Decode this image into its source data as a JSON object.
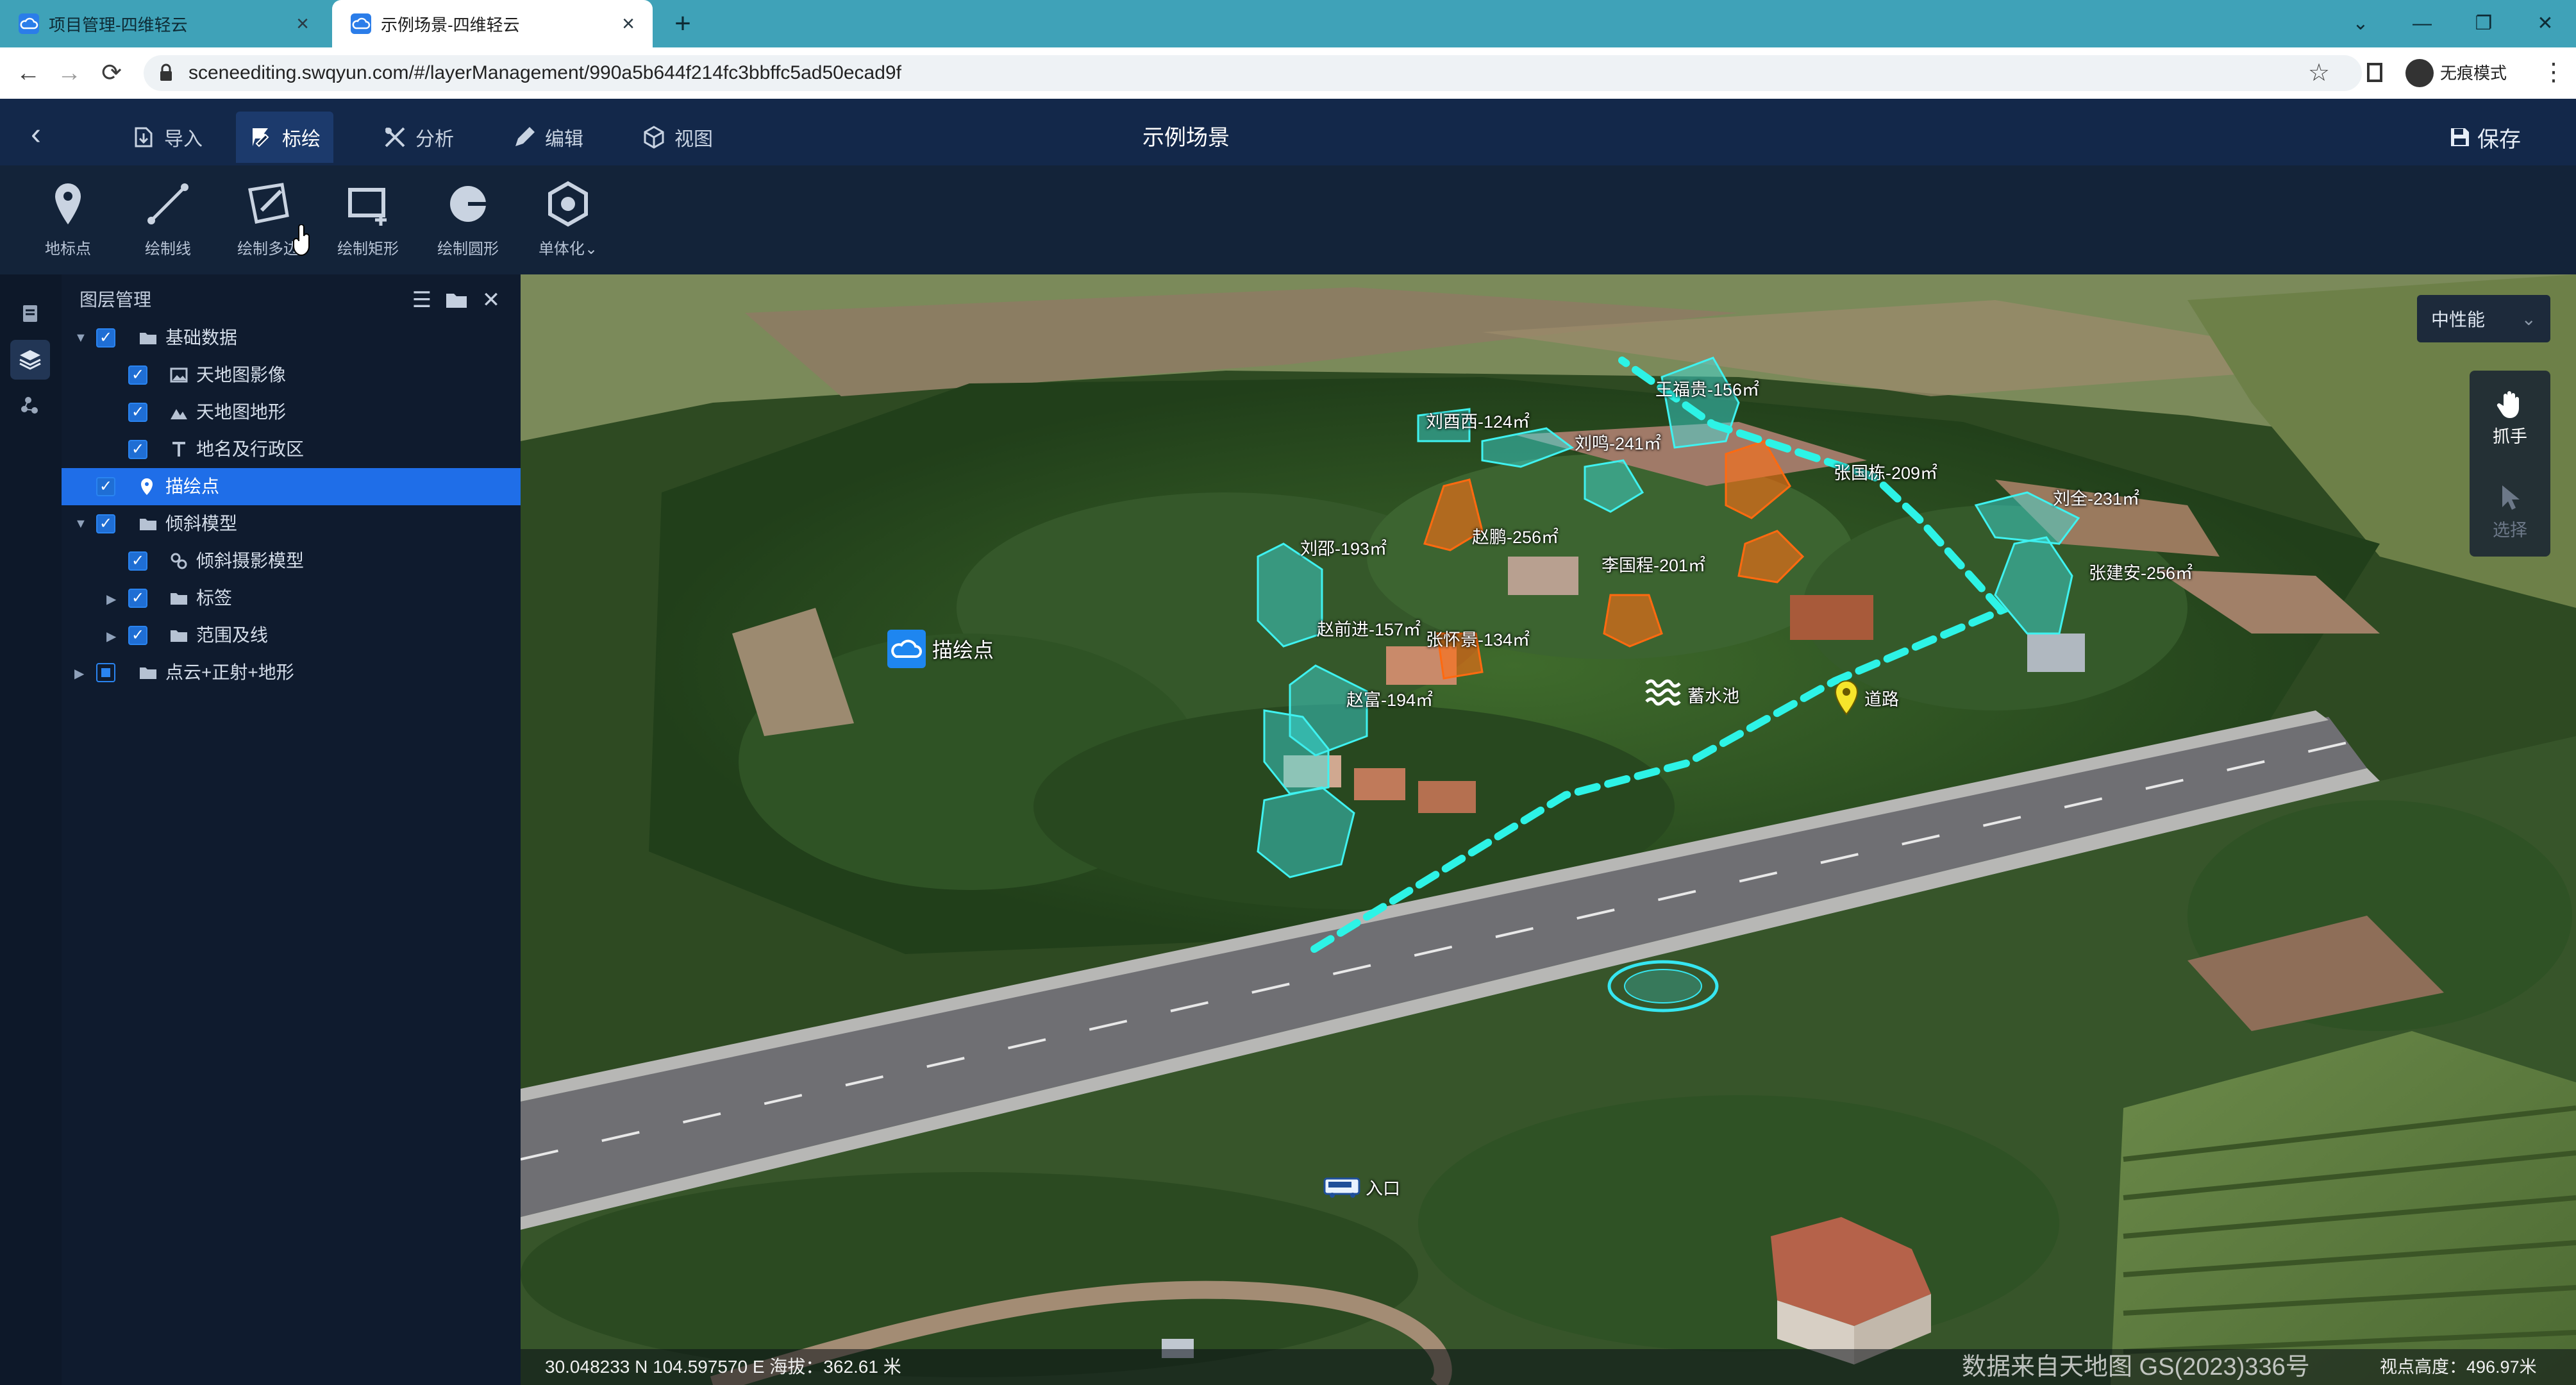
{
  "browser": {
    "tabs": [
      {
        "title": "项目管理-四维轻云",
        "active": false
      },
      {
        "title": "示例场景-四维轻云",
        "active": true
      }
    ],
    "url": "sceneediting.swqyun.com/#/layerManagement/990a5b644f214fc3bbffc5ad50ecad9f",
    "profile_label": "无痕模式"
  },
  "header": {
    "menus": [
      {
        "label": "导入",
        "icon": "import-icon",
        "active": false
      },
      {
        "label": "标绘",
        "icon": "flag-draw-icon",
        "active": true
      },
      {
        "label": "分析",
        "icon": "analysis-icon",
        "active": false
      },
      {
        "label": "编辑",
        "icon": "pencil-icon",
        "active": false
      },
      {
        "label": "视图",
        "icon": "cube-icon",
        "active": false
      }
    ],
    "title": "示例场景",
    "save_label": "保存"
  },
  "toolbar": {
    "tools": [
      {
        "label": "地标点",
        "icon": "map-pin-icon"
      },
      {
        "label": "绘制线",
        "icon": "draw-line-icon"
      },
      {
        "label": "绘制多边",
        "icon": "draw-polygon-icon"
      },
      {
        "label": "绘制矩形",
        "icon": "draw-rectangle-icon"
      },
      {
        "label": "绘制圆形",
        "icon": "draw-circle-icon"
      },
      {
        "label": "单体化",
        "icon": "hexagon-icon"
      }
    ]
  },
  "layers": {
    "title": "图层管理",
    "items": [
      {
        "label": "基础数据",
        "level": 0,
        "expanded": true,
        "checked": "full",
        "icon": "folder-icon"
      },
      {
        "label": "天地图影像",
        "level": 1,
        "checked": "full",
        "icon": "image-icon"
      },
      {
        "label": "天地图地形",
        "level": 1,
        "checked": "full",
        "icon": "mountain-icon"
      },
      {
        "label": "地名及行政区",
        "level": 1,
        "checked": "full",
        "icon": "text-icon"
      },
      {
        "label": "描绘点",
        "level": 0,
        "checked": "full",
        "icon": "map-pin-icon",
        "selected": true
      },
      {
        "label": "倾斜模型",
        "level": 0,
        "expanded": true,
        "checked": "full",
        "icon": "folder-icon"
      },
      {
        "label": "倾斜摄影模型",
        "level": 1,
        "checked": "full",
        "icon": "model-icon"
      },
      {
        "label": "标签",
        "level": 1,
        "collapsed": true,
        "checked": "full",
        "icon": "folder-icon"
      },
      {
        "label": "范围及线",
        "level": 1,
        "collapsed": true,
        "checked": "full",
        "icon": "folder-icon"
      },
      {
        "label": "点云+正射+地形",
        "level": 0,
        "collapsed": true,
        "checked": "partial",
        "icon": "folder-icon"
      }
    ]
  },
  "map": {
    "performance": "中性能",
    "modes": [
      {
        "label": "抓手",
        "icon": "hand-icon",
        "active": true
      },
      {
        "label": "选择",
        "icon": "cursor-icon",
        "active": false
      }
    ],
    "markers": {
      "point_label": "描绘点",
      "pool_label": "蓄水池",
      "road_label": "道路",
      "entrance_label": "入口"
    },
    "house_labels": [
      "王福贵-156㎡",
      "刘酉西-124㎡",
      "刘鸣-241㎡",
      "张国栋-209㎡",
      "刘全-231㎡",
      "刘邵-193㎡",
      "赵鹏-256㎡",
      "李国程-201㎡",
      "张建安-256㎡",
      "赵前进-157㎡",
      "张怀景-134㎡",
      "赵富-194㎡"
    ],
    "status": {
      "coords": "30.048233 N 104.597570 E 海拔：362.61 米",
      "attribution": "数据来自天地图 GS(2023)336号",
      "view_height": "视点高度：496.97米"
    }
  }
}
